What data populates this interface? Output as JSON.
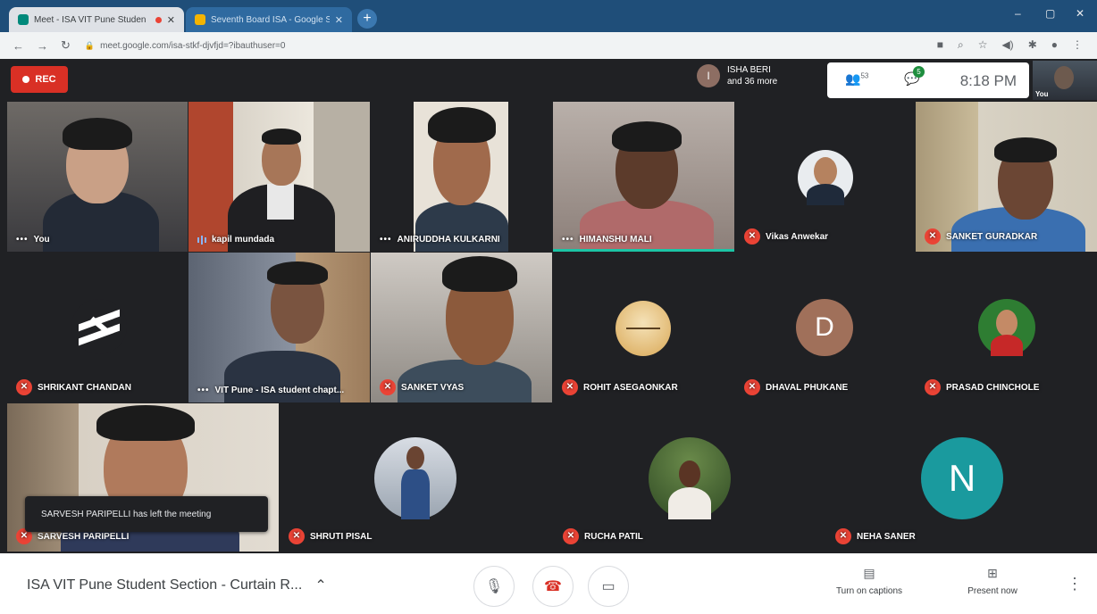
{
  "browser": {
    "tabs": [
      {
        "title": "Meet - ISA VIT Pune Studen",
        "active": true
      },
      {
        "title": "Seventh Board ISA - Google Slides",
        "active": false
      }
    ],
    "url": "meet.google.com/isa-stkf-djvfjd=?ibauthuser=0",
    "window_controls": [
      "–",
      "▢",
      "✕"
    ]
  },
  "meet_top": {
    "rec_label": "REC",
    "presenter_initial": "I",
    "presenter_line1": "ISHA BERI",
    "presenter_line2": "and 36 more",
    "participant_count": "53",
    "chat_badge": "5",
    "time": "8:18 PM",
    "self_label": "You"
  },
  "tiles": [
    {
      "name": "You"
    },
    {
      "name": "kapil mundada"
    },
    {
      "name": "ANIRUDDHA KULKARNI"
    },
    {
      "name": "HIMANSHU MALI"
    },
    {
      "name": "Vikas Anwekar"
    },
    {
      "name": "SANKET GURADKAR"
    },
    {
      "name": "SHRIKANT CHANDAN"
    },
    {
      "name": "VIT Pune - ISA student chapt..."
    },
    {
      "name": "SANKET VYAS"
    },
    {
      "name": "ROHIT ASEGAONKAR"
    },
    {
      "name": "DHAVAL PHUKANE",
      "initial": "D"
    },
    {
      "name": "PRASAD CHINCHOLE"
    },
    {
      "name": "SARVESH PARIPELLI"
    },
    {
      "name": "SHRUTI PISAL"
    },
    {
      "name": "RUCHA PATIL"
    },
    {
      "name": "NEHA SANER",
      "initial": "N"
    }
  ],
  "toast": "SARVESH PARIPELLI has left the meeting",
  "bottom": {
    "meeting_name": "ISA VIT Pune Student Section - Curtain R...",
    "captions_label": "Turn on captions",
    "present_label": "Present now"
  },
  "colors": {
    "rec": "#d93025",
    "mic_off": "#ea4335",
    "speaking": "#1bc5a6",
    "neha_avatar": "#1a9a9e",
    "dhaval_avatar": "#a0705a"
  }
}
